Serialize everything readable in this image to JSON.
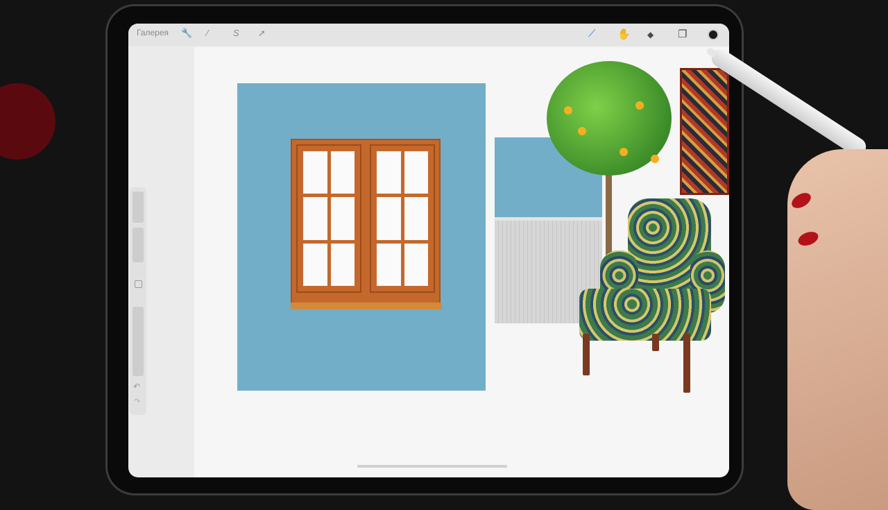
{
  "toolbar": {
    "gallery_label": "Галерея",
    "left_tools": [
      "wrench-icon",
      "magic-wand-icon",
      "selection-icon",
      "transform-arrow-icon"
    ],
    "right_tools": [
      "brush-icon",
      "smudge-icon",
      "eraser-icon",
      "layers-icon"
    ],
    "active_tool": "brush-icon",
    "current_color": "#1a1a1a"
  },
  "colors": {
    "wall_blue": "#72aec7",
    "window_frame": "#c4682c",
    "canvas_bg": "#f6f6f6",
    "ui_bg": "#ebebeb",
    "accent_brush": "#2f7fd6"
  },
  "icons": {
    "wrench": "🔧",
    "wand": "⁄",
    "selection": "S",
    "transform": "➚",
    "brush": "⟋",
    "smudge": "✋",
    "eraser": "◆",
    "layers": "❐",
    "undo": "↶",
    "redo": "↷"
  }
}
